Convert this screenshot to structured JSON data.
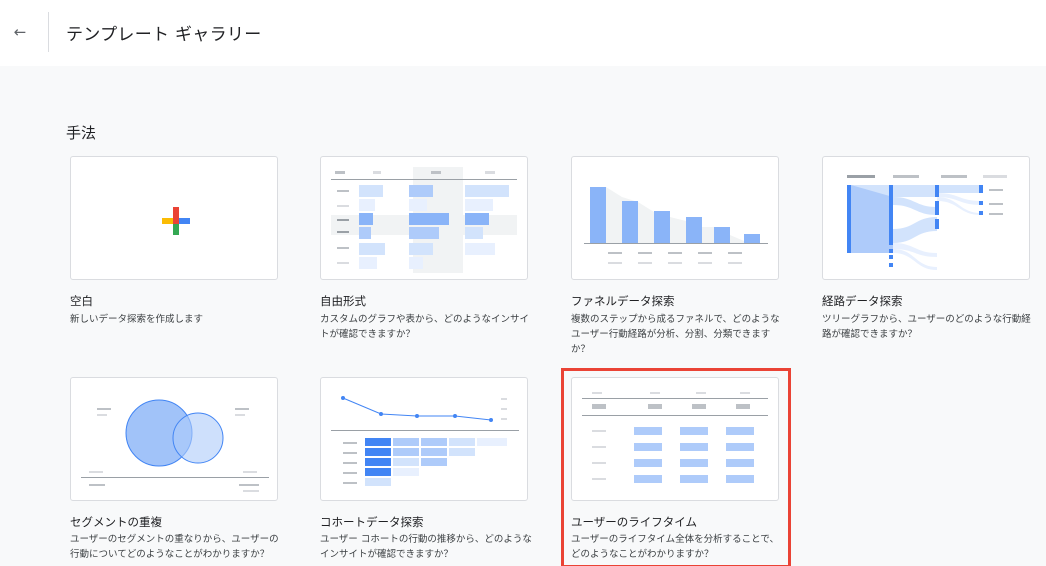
{
  "header": {
    "back_icon": "arrow-back-icon",
    "title": "テンプレート ギャラリー"
  },
  "section_title": "手法",
  "templates": [
    {
      "title": "空白",
      "desc": "新しいデータ探索を作成します",
      "icon": "plus-icon"
    },
    {
      "title": "自由形式",
      "desc": "カスタムのグラフや表から、どのようなインサイトが確認できますか？"
    },
    {
      "title": "ファネルデータ探索",
      "desc": "複数のステップから成るファネルで、どのようなユーザー行動経路が分析、分割、分類できますか？"
    },
    {
      "title": "経路データ探索",
      "desc": "ツリーグラフから、ユーザーのどのような行動経路が確認できますか？"
    },
    {
      "title": "セグメントの重複",
      "desc": "ユーザーのセグメントの重なりから、ユーザーの行動についてどのようなことがわかりますか？"
    },
    {
      "title": "コホートデータ探索",
      "desc": "ユーザー コホートの行動の推移から、どのようなインサイトが確認できますか？"
    },
    {
      "title": "ユーザーのライフタイム",
      "desc": "ユーザーのライフタイム全体を分析することで、どのようなことがわかりますか？"
    }
  ],
  "colors": {
    "accent_blue": "#8ab4f8",
    "light_blue": "#d2e3fc",
    "highlight_border": "#ea4335",
    "plus_red": "#ea4335",
    "plus_yellow": "#fbbc04",
    "plus_green": "#34a853",
    "plus_blue": "#4285f4"
  }
}
